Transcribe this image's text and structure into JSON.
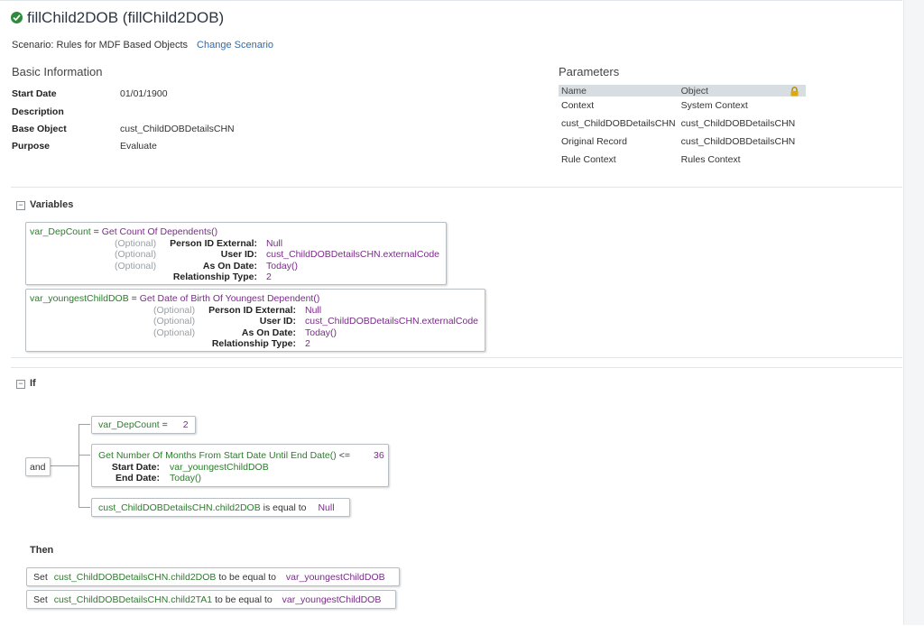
{
  "header": {
    "title": "fillChild2DOB (fillChild2DOB)",
    "scenario_label": "Scenario: Rules for MDF Based Objects",
    "change_scenario_label": "Change Scenario"
  },
  "basic": {
    "heading": "Basic Information",
    "fields": [
      {
        "label": "Start Date",
        "value": "01/01/1900"
      },
      {
        "label": "Description",
        "value": ""
      },
      {
        "label": "Base Object",
        "value": "cust_ChildDOBDetailsCHN"
      },
      {
        "label": "Purpose",
        "value": "Evaluate"
      }
    ]
  },
  "parameters": {
    "heading": "Parameters",
    "columns": [
      "Name",
      "Object"
    ],
    "rows": [
      {
        "name": "Context",
        "object": "System Context",
        "locked": true
      },
      {
        "name": "cust_ChildDOBDetailsCHN",
        "object": "cust_ChildDOBDetailsCHN",
        "locked": false
      },
      {
        "name": "Original Record",
        "object": "cust_ChildDOBDetailsCHN",
        "locked": true
      },
      {
        "name": "Rule Context",
        "object": "Rules Context",
        "locked": true
      }
    ]
  },
  "variables": {
    "heading": "Variables",
    "toggle": "−",
    "items": [
      {
        "var": "var_DepCount",
        "eq": "=",
        "func": "Get Count Of Dependents()",
        "params": [
          {
            "optional": "(Optional)",
            "label": "Person ID External:",
            "value": "Null"
          },
          {
            "optional": "(Optional)",
            "label": "User ID:",
            "value": "cust_ChildDOBDetailsCHN.externalCode"
          },
          {
            "optional": "(Optional)",
            "label": "As On Date:",
            "value": "Today()"
          },
          {
            "optional": "",
            "label": "Relationship Type:",
            "value": "2"
          }
        ]
      },
      {
        "var": "var_youngestChildDOB",
        "eq": "=",
        "func": "Get Date of Birth Of Youngest Dependent()",
        "params": [
          {
            "optional": "(Optional)",
            "label": "Person ID External:",
            "value": "Null"
          },
          {
            "optional": "(Optional)",
            "label": "User ID:",
            "value": "cust_ChildDOBDetailsCHN.externalCode"
          },
          {
            "optional": "(Optional)",
            "label": "As On Date:",
            "value": "Today()"
          },
          {
            "optional": "",
            "label": "Relationship Type:",
            "value": "2"
          }
        ]
      }
    ]
  },
  "if_section": {
    "heading": "If",
    "toggle": "−",
    "operator": "and",
    "cond1": {
      "left": "var_DepCount",
      "op": "=",
      "right": "2"
    },
    "cond2": {
      "func": "Get Number Of Months From Start Date Until End Date()",
      "op": "<=",
      "right": "36",
      "params": [
        {
          "label": "Start Date:",
          "value": "var_youngestChildDOB"
        },
        {
          "label": "End Date:",
          "value": "Today()"
        }
      ]
    },
    "cond3": {
      "left": "cust_ChildDOBDetailsCHN.child2DOB",
      "op": "is equal to",
      "right": "Null"
    }
  },
  "then_section": {
    "heading": "Then",
    "actions": [
      {
        "set": "Set",
        "field": "cust_ChildDOBDetailsCHN.child2DOB",
        "op": "to be equal to",
        "value": "var_youngestChildDOB"
      },
      {
        "set": "Set",
        "field": "cust_ChildDOBDetailsCHN.child2TA1",
        "op": "to be equal to",
        "value": "var_youngestChildDOB"
      }
    ]
  },
  "colors": {
    "link": "#2b6bb0",
    "success": "#2f8a3b",
    "green_text": "#2a7d2a",
    "purple_text": "#7a2a8a",
    "lock": "#e0a800"
  }
}
